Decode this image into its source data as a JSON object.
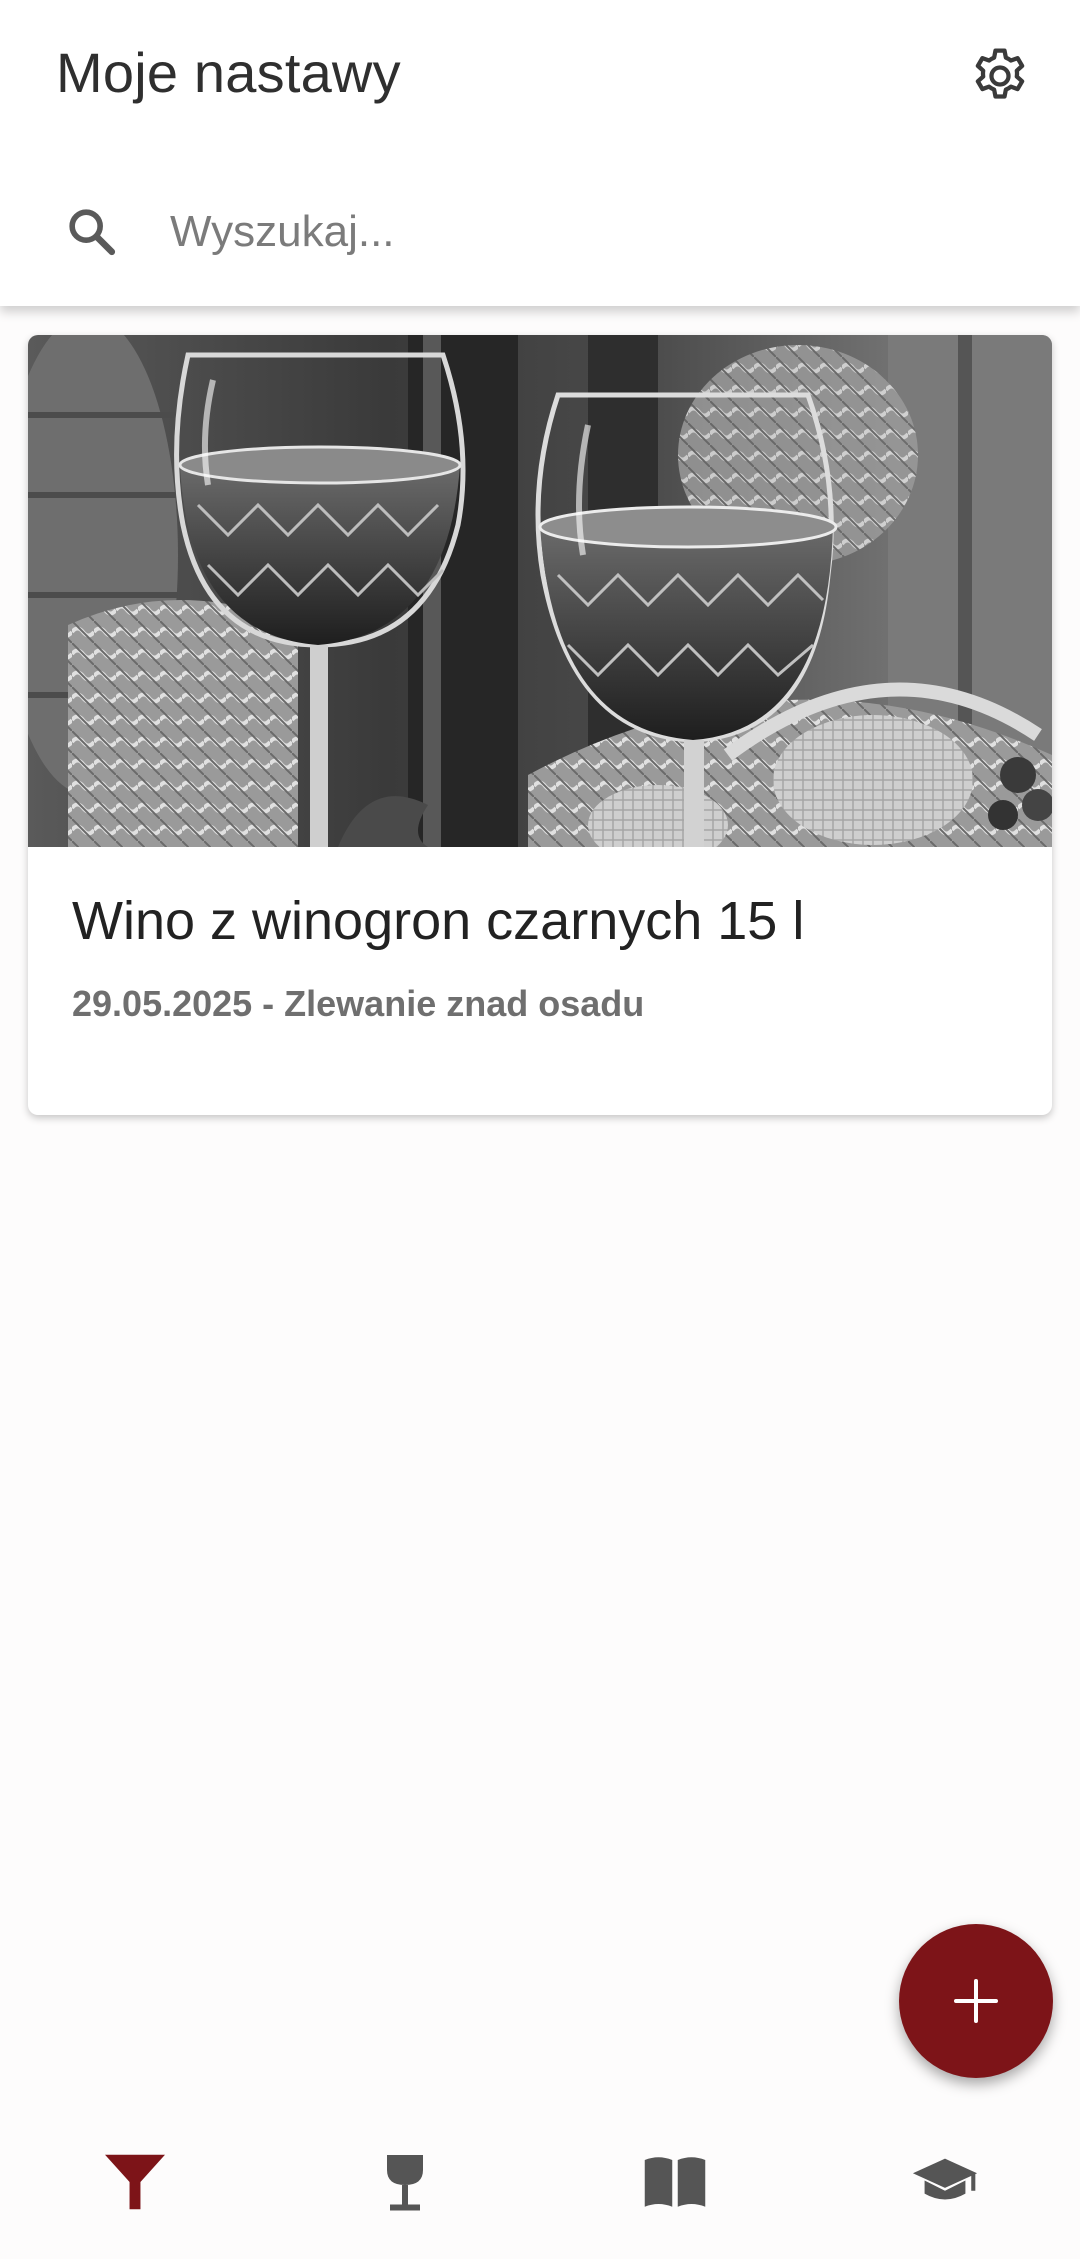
{
  "header": {
    "title": "Moje nastawy",
    "settings_icon": "gear-icon"
  },
  "search": {
    "placeholder": "Wyszukaj...",
    "value": "",
    "icon": "search-icon"
  },
  "batches": [
    {
      "title": "Wino z winogron czarnych 15 l",
      "subtitle": "29.05.2025 - Zlewanie znad osadu",
      "image": "wine-glasses-photo"
    }
  ],
  "fab": {
    "icon": "plus-icon"
  },
  "bottom_nav": {
    "items": [
      {
        "icon": "funnel-icon",
        "active": true
      },
      {
        "icon": "wine-glass-icon",
        "active": false
      },
      {
        "icon": "book-icon",
        "active": false
      },
      {
        "icon": "graduation-cap-icon",
        "active": false
      }
    ]
  },
  "colors": {
    "accent": "#7d1418",
    "icon_inactive": "#555555",
    "title_text": "#2f2f2f",
    "subtitle_text": "#6f6f6f"
  }
}
